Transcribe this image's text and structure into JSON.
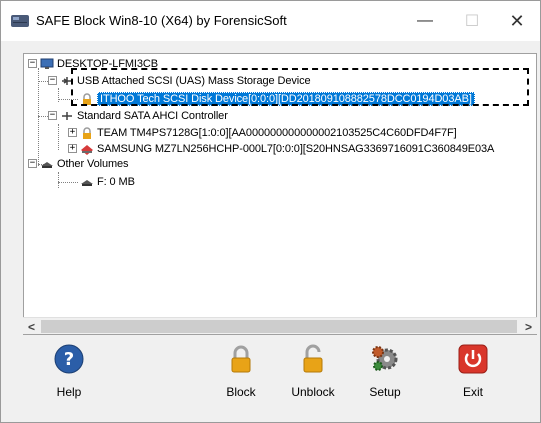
{
  "window": {
    "title": "SAFE Block Win8-10 (X64) by ForensicSoft",
    "minimize_glyph": "—",
    "maximize_glyph": "☐",
    "close_glyph": "✕"
  },
  "tree": {
    "root": {
      "label": "DESKTOP-LFMI3CB",
      "icon": "computer-icon"
    },
    "usb_controller": {
      "label": "USB Attached SCSI (UAS) Mass Storage Device",
      "icon": "usb-icon"
    },
    "usb_disk": {
      "label": "ITHOO Tech SCSI Disk Device[0:0:0][DD201809108882578DCC0194D03AB]",
      "icon": "lock-icon",
      "selected": true
    },
    "sata_controller": {
      "label": "Standard SATA AHCI Controller",
      "icon": "controller-icon"
    },
    "team_disk": {
      "label": "TEAM TM4PS7128G[1:0:0][AA000000000000002103525C4C60DFD4F7F]",
      "icon": "lock-icon"
    },
    "samsung_disk": {
      "label": "SAMSUNG MZ7LN256HCHP-000L7[0:0:0][S20HNSAG3369716091C360849E03A",
      "icon": "disk-arrow-icon"
    },
    "other_volumes": {
      "label": "Other Volumes",
      "icon": "drive-icon"
    },
    "volume_f": {
      "label": "F: 0 MB",
      "icon": "drive-icon"
    }
  },
  "scrollbar": {
    "left_glyph": "<",
    "right_glyph": ">"
  },
  "toolbar": {
    "help_label": "Help",
    "block_label": "Block",
    "unblock_label": "Unblock",
    "setup_label": "Setup",
    "exit_label": "Exit"
  },
  "colors": {
    "selection": "#0078d7",
    "lock": "#e8a317",
    "help_blue": "#2b5ea8",
    "exit_red": "#d9362b"
  }
}
